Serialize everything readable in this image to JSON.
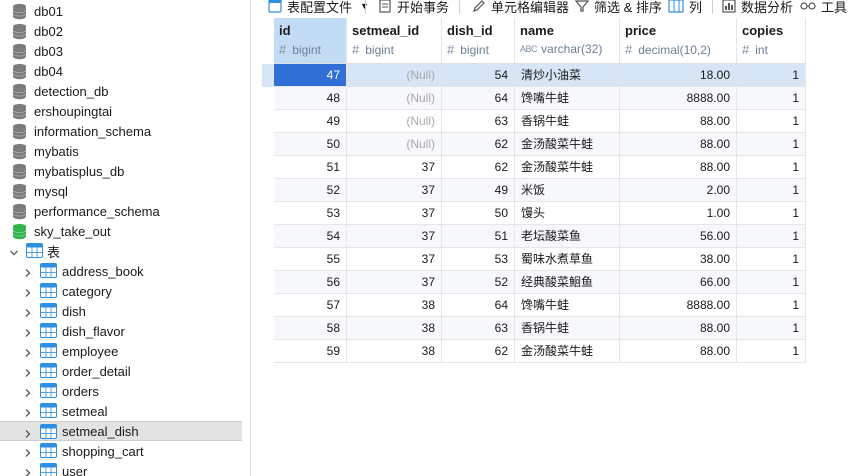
{
  "toolbar": {
    "items": [
      "表配置文件",
      "开始事务",
      "单元格编辑器",
      "筛选 & 排序",
      "列",
      "数据分析",
      "工具"
    ]
  },
  "sidebar": {
    "databases": [
      {
        "name": "db01",
        "open": false
      },
      {
        "name": "db02",
        "open": false
      },
      {
        "name": "db03",
        "open": false
      },
      {
        "name": "db04",
        "open": false
      },
      {
        "name": "detection_db",
        "open": false
      },
      {
        "name": "ershoupingtai",
        "open": false
      },
      {
        "name": "information_schema",
        "open": false
      },
      {
        "name": "mybatis",
        "open": false
      },
      {
        "name": "mybatisplus_db",
        "open": false
      },
      {
        "name": "mysql",
        "open": false
      },
      {
        "name": "performance_schema",
        "open": false
      },
      {
        "name": "sky_take_out",
        "open": true
      }
    ],
    "tables_folder_label": "表",
    "tables": [
      "address_book",
      "category",
      "dish",
      "dish_flavor",
      "employee",
      "order_detail",
      "orders",
      "setmeal",
      "setmeal_dish",
      "shopping_cart",
      "user"
    ],
    "selected_table": "setmeal_dish"
  },
  "grid": {
    "columns": [
      {
        "name": "id",
        "type": "bigint",
        "kind": "num"
      },
      {
        "name": "setmeal_id",
        "type": "bigint",
        "kind": "num"
      },
      {
        "name": "dish_id",
        "type": "bigint",
        "kind": "num"
      },
      {
        "name": "name",
        "type": "varchar(32)",
        "kind": "text"
      },
      {
        "name": "price",
        "type": "decimal(10,2)",
        "kind": "num"
      },
      {
        "name": "copies",
        "type": "int",
        "kind": "num"
      }
    ],
    "null_text": "(Null)",
    "rows": [
      [
        "47",
        "(Null)",
        "54",
        "清炒小油菜",
        "18.00",
        "1"
      ],
      [
        "48",
        "(Null)",
        "64",
        "馋嘴牛蛙",
        "8888.00",
        "1"
      ],
      [
        "49",
        "(Null)",
        "63",
        "香锅牛蛙",
        "88.00",
        "1"
      ],
      [
        "50",
        "(Null)",
        "62",
        "金汤酸菜牛蛙",
        "88.00",
        "1"
      ],
      [
        "51",
        "37",
        "62",
        "金汤酸菜牛蛙",
        "88.00",
        "1"
      ],
      [
        "52",
        "37",
        "49",
        "米饭",
        "2.00",
        "1"
      ],
      [
        "53",
        "37",
        "50",
        "馒头",
        "1.00",
        "1"
      ],
      [
        "54",
        "37",
        "51",
        "老坛酸菜鱼",
        "56.00",
        "1"
      ],
      [
        "55",
        "37",
        "53",
        "蜀味水煮草鱼",
        "38.00",
        "1"
      ],
      [
        "56",
        "37",
        "52",
        "经典酸菜鮰鱼",
        "66.00",
        "1"
      ],
      [
        "57",
        "38",
        "64",
        "馋嘴牛蛙",
        "8888.00",
        "1"
      ],
      [
        "58",
        "38",
        "63",
        "香锅牛蛙",
        "88.00",
        "1"
      ],
      [
        "59",
        "38",
        "62",
        "金汤酸菜牛蛙",
        "88.00",
        "1"
      ]
    ],
    "selected_row": 0,
    "active_cell": [
      0,
      0
    ]
  },
  "colors": {
    "db_closed": "#7a7a7a",
    "db_open": "#2fb34a",
    "table_icon": "#2f8fe0",
    "selection": "#d6e6f6",
    "active_cell": "#2f6fd6"
  }
}
